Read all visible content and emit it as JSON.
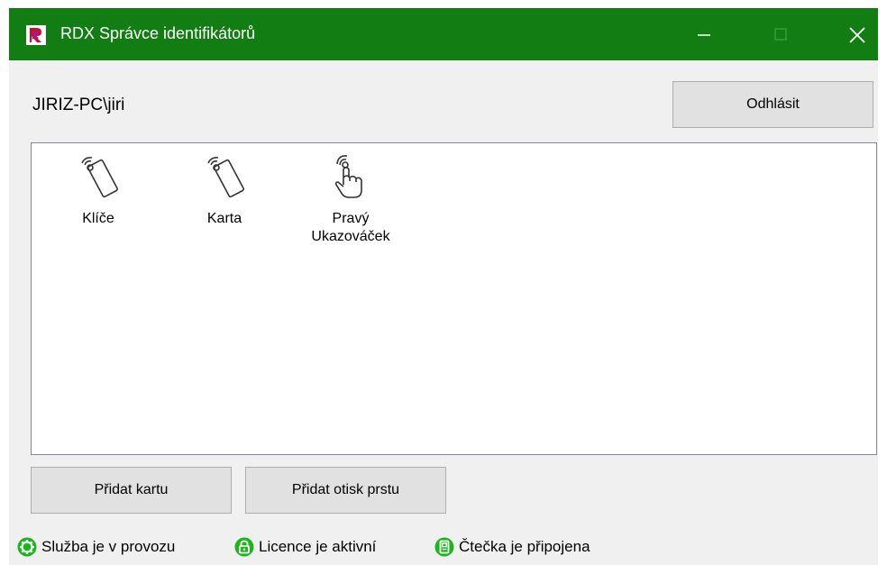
{
  "window": {
    "title": "RDX Správce identifikátorů",
    "title_bar_color": "#117d12"
  },
  "user": {
    "name": "JIRIZ-PC\\jiri",
    "logout_label": "Odhlásit"
  },
  "identifiers": [
    {
      "label": "Klíče",
      "icon": "card-tap-icon"
    },
    {
      "label": "Karta",
      "icon": "card-tap-icon"
    },
    {
      "label": "Pravý\nUkazováček",
      "icon": "fingerprint-hand-icon"
    }
  ],
  "actions": {
    "add_card_label": "Přidat kartu",
    "add_fingerprint_label": "Přidat otisk prstu"
  },
  "status": {
    "service": "Služba je v provozu",
    "license": "Licence je aktivní",
    "reader": "Čtečka je připojena",
    "ok_color": "#1cb51c"
  }
}
